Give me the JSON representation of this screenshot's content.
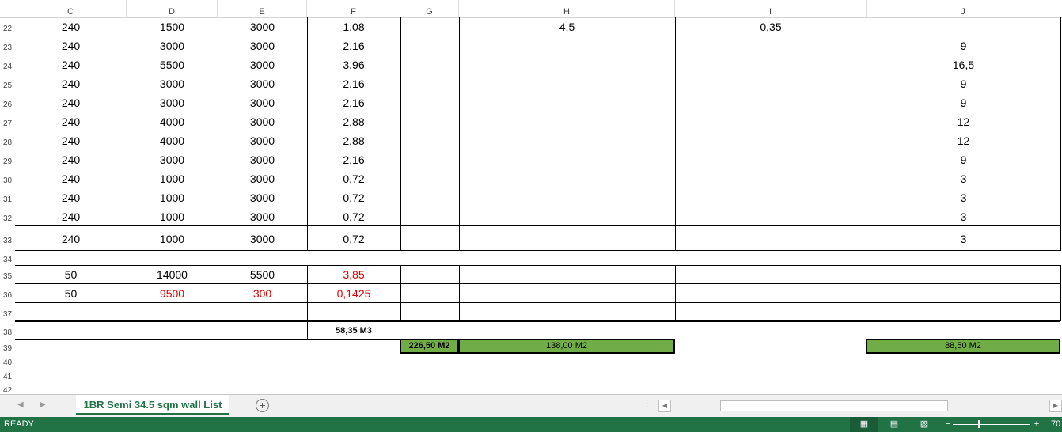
{
  "columns": [
    "C",
    "D",
    "E",
    "F",
    "G",
    "H",
    "I",
    "J"
  ],
  "rows": [
    {
      "num": "22",
      "c": "240",
      "d": "1500",
      "e": "3000",
      "f": "1,08",
      "g": "",
      "h": "4,5",
      "i": "0,35",
      "j": ""
    },
    {
      "num": "23",
      "c": "240",
      "d": "3000",
      "e": "3000",
      "f": "2,16",
      "g": "",
      "h": "",
      "i": "",
      "j": "9"
    },
    {
      "num": "24",
      "c": "240",
      "d": "5500",
      "e": "3000",
      "f": "3,96",
      "g": "",
      "h": "",
      "i": "",
      "j": "16,5"
    },
    {
      "num": "25",
      "c": "240",
      "d": "3000",
      "e": "3000",
      "f": "2,16",
      "g": "",
      "h": "",
      "i": "",
      "j": "9"
    },
    {
      "num": "26",
      "c": "240",
      "d": "3000",
      "e": "3000",
      "f": "2,16",
      "g": "",
      "h": "",
      "i": "",
      "j": "9"
    },
    {
      "num": "27",
      "c": "240",
      "d": "4000",
      "e": "3000",
      "f": "2,88",
      "g": "",
      "h": "",
      "i": "",
      "j": "12"
    },
    {
      "num": "28",
      "c": "240",
      "d": "4000",
      "e": "3000",
      "f": "2,88",
      "g": "",
      "h": "",
      "i": "",
      "j": "12"
    },
    {
      "num": "29",
      "c": "240",
      "d": "3000",
      "e": "3000",
      "f": "2,16",
      "g": "",
      "h": "",
      "i": "",
      "j": "9"
    },
    {
      "num": "30",
      "c": "240",
      "d": "1000",
      "e": "3000",
      "f": "0,72",
      "g": "",
      "h": "",
      "i": "",
      "j": "3"
    },
    {
      "num": "31",
      "c": "240",
      "d": "1000",
      "e": "3000",
      "f": "0,72",
      "g": "",
      "h": "",
      "i": "",
      "j": "3"
    },
    {
      "num": "32",
      "c": "240",
      "d": "1000",
      "e": "3000",
      "f": "0,72",
      "g": "",
      "h": "",
      "i": "",
      "j": "3"
    },
    {
      "num": "33",
      "c": "240",
      "d": "1000",
      "e": "3000",
      "f": "0,72",
      "g": "",
      "h": "",
      "i": "",
      "j": "3"
    },
    {
      "num": "34"
    },
    {
      "num": "35",
      "c": "50",
      "d": "14000",
      "e": "5500",
      "f": "3,85",
      "g": "",
      "h": "",
      "i": "",
      "j": "",
      "red": [
        "f"
      ]
    },
    {
      "num": "36",
      "c": "50",
      "d": "9500",
      "e": "300",
      "f": "0,1425",
      "g": "",
      "h": "",
      "i": "",
      "j": "",
      "red": [
        "d",
        "e",
        "f"
      ]
    },
    {
      "num": "37",
      "c": "",
      "d": "",
      "e": "",
      "f": "",
      "g": "",
      "h": "",
      "i": "",
      "j": ""
    },
    {
      "num": "38"
    },
    {
      "num": "39"
    },
    {
      "num": "40"
    },
    {
      "num": "41"
    },
    {
      "num": "42"
    }
  ],
  "totals": {
    "volume": "58,35 M3",
    "area_total": "226,50 M2",
    "area_h": "138,00 M2",
    "area_j": "88,50 M2"
  },
  "sheet_tab": "1BR Semi 34.5 sqm wall List",
  "add_sheet": "+",
  "status": {
    "ready": "READY",
    "zoom": "70"
  },
  "colors": {
    "accent": "#217346",
    "green_fill": "#70ad47",
    "red_text": "#e00000"
  }
}
